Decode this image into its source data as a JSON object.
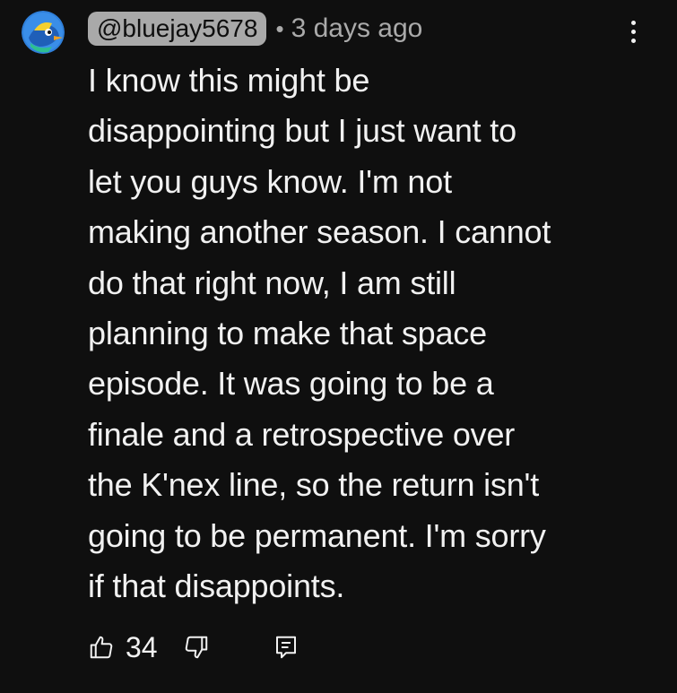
{
  "comment": {
    "author_handle": "@bluejay5678",
    "separator": "•",
    "timestamp": "3 days ago",
    "text": "I know this might be\ndisappointing but I just want to\nlet you guys know. I'm not\nmaking another season. I cannot\ndo that right now, I am still\nplanning to make that space\nepisode. It was going to be a\nfinale and a retrospective over\nthe K'nex line, so the return isn't\ngoing to be permanent. I'm sorry\nif that disappoints.",
    "like_count": "34"
  },
  "icons": {
    "avatar": "bluejay-avatar",
    "more": "more-vertical-icon",
    "like": "thumbs-up-icon",
    "dislike": "thumbs-down-icon",
    "reply": "reply-comment-icon"
  },
  "colors": {
    "background": "#0f0f0f",
    "text": "#f1f1f1",
    "secondary_text": "#aaaaaa",
    "handle_chip": "#a9a9a9"
  }
}
